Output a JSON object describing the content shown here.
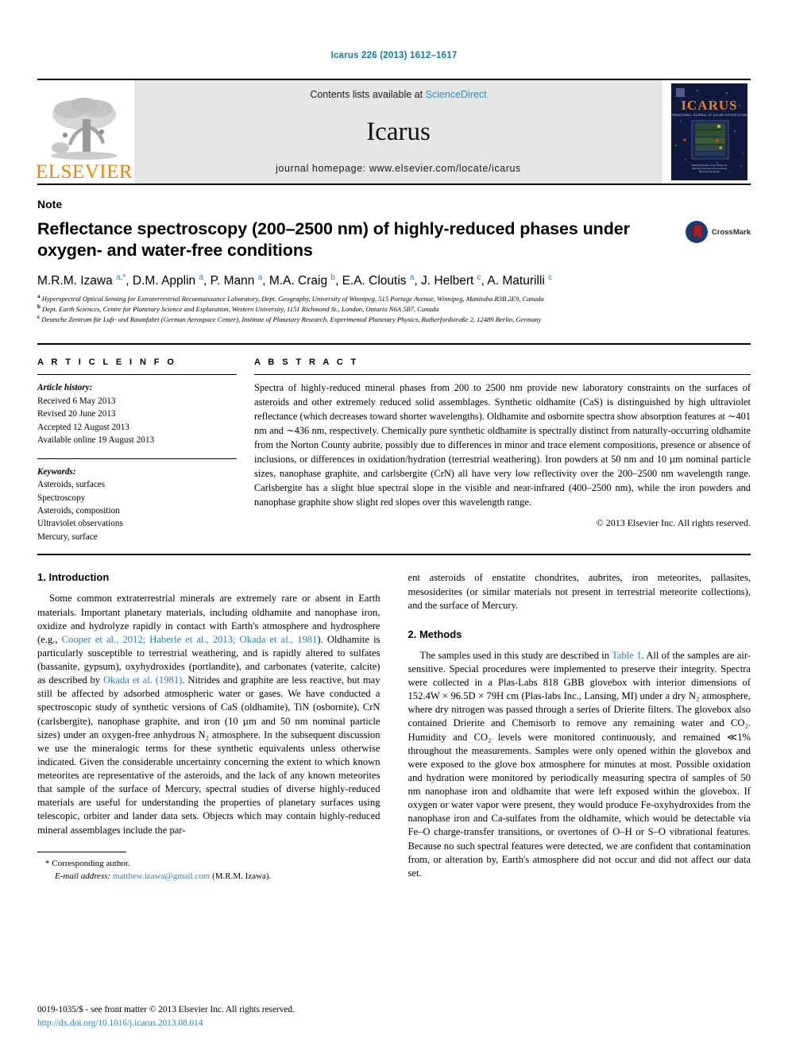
{
  "running_head": "Icarus 226 (2013) 1612–1617",
  "masthead": {
    "publisher_word": "ELSEVIER",
    "contents_prefix": "Contents lists available at ",
    "contents_link": "ScienceDirect",
    "journal_name": "Icarus",
    "journal_homepage": "journal homepage: www.elsevier.com/locate/icarus",
    "cover_title": "ICARUS",
    "cover_subtitle": "INTERNATIONAL JOURNAL OF SOLAR SYSTEM STUDIES",
    "cover_footer": "Official Publication of the Division for Planetary Sciences of the American Astronomical Society"
  },
  "article": {
    "type_label": "Note",
    "title": "Reflectance spectroscopy (200–2500 nm) of highly-reduced phases under oxygen- and water-free conditions",
    "crossmark_label": "CrossMark",
    "authors_html": "M.R.M. Izawa <sup>a,*</sup>, D.M. Applin <sup>a</sup>, P. Mann <sup>a</sup>, M.A. Craig <sup>b</sup>, E.A. Cloutis <sup>a</sup>, J. Helbert <sup>c</sup>, A. Maturilli <sup>c</sup>",
    "affiliations": [
      "Hyperspectral Optical Sensing for Extraterrestrial Reconnaissance Laboratory, Dept. Geography, University of Winnipeg, 515 Portage Avenue, Winnipeg, Manitoba R3B 2E9, Canada",
      "Dept. Earth Sciences, Centre for Planetary Science and Exploration, Western University, 1151 Richmond St., London, Ontario N6A 5B7, Canada",
      "Deutsche Zentrum für Luft- und Raumfahrt (German Aerospace Center), Institute of Planetary Research, Experimental Planetary Physics, Rutherfordstraße 2, 12489 Berlin, Germany"
    ],
    "affiliation_marks": [
      "a",
      "b",
      "c"
    ]
  },
  "article_info": {
    "heading": "A R T I C L E    I N F O",
    "history_label": "Article history:",
    "history": [
      "Received 6 May 2013",
      "Revised 20 June 2013",
      "Accepted 12 August 2013",
      "Available online 19 August 2013"
    ],
    "keywords_label": "Keywords:",
    "keywords": [
      "Asteroids, surfaces",
      "Spectroscopy",
      "Asteroids, composition",
      "Ultraviolet observations",
      "Mercury, surface"
    ]
  },
  "abstract": {
    "heading": "A B S T R A C T",
    "text": "Spectra of highly-reduced mineral phases from 200 to 2500 nm provide new laboratory constraints on the surfaces of asteroids and other extremely reduced solid assemblages. Synthetic oldhamite (CaS) is distinguished by high ultraviolet reflectance (which decreases toward shorter wavelengths). Oldhamite and osbornite spectra show absorption features at ∼401 nm and ∼436 nm, respectively. Chemically pure synthetic oldhamite is spectrally distinct from naturally-occurring oldhamite from the Norton County aubrite, possibly due to differences in minor and trace element compositions, presence or absence of inclusions, or differences in oxidation/hydration (terrestrial weathering). Iron powders at 50 nm and 10 µm nominal particle sizes, nanophase graphite, and carlsbergite (CrN) all have very low reflectivity over the 200–2500 nm wavelength range. Carlsbergite has a slight blue spectral slope in the visible and near-infrared (400–2500 nm), while the iron powders and nanophase graphite show slight red slopes over this wavelength range.",
    "copyright": "© 2013 Elsevier Inc. All rights reserved."
  },
  "body": {
    "intro_heading": "1. Introduction",
    "methods_heading": "2. Methods",
    "intro_p1_a": "Some common extraterrestrial minerals are extremely rare or absent in Earth materials. Important planetary materials, including oldhamite and nanophase iron, oxidize and hydrolyze rapidly in contact with Earth's atmosphere and hydrosphere (e.g., ",
    "intro_ref1": "Cooper et al., 2012; Haberle et al., 2013; Okada et al., 1981",
    "intro_p1_b": "). Oldhamite is particularly susceptible to terrestrial weathering, and is rapidly altered to sulfates (bassanite, gypsum), oxyhydroxides (portlandite), and carbonates (vaterite, calcite) as described by ",
    "intro_ref2": "Okada et al. (1981)",
    "intro_p1_c": ". Nitrides and graphite are less reactive, but may still be affected by adsorbed atmospheric water or gases. We have conducted a spectroscopic study of synthetic versions of CaS (oldhamite), TiN (osbornite), CrN (carlsbergite), nanophase graphite, and iron (10 µm and 50 nm nominal particle sizes) under an oxygen-free anhydrous N₂ atmosphere. In the subsequent discussion we use the mineralogic terms for these synthetic equivalents unless otherwise indicated. Given the considerable uncertainty concerning the extent to which known meteorites are representative of the asteroids, and the lack of any known meteorites that sample of the surface of Mercury, spectral studies of diverse highly-reduced materials are useful for understanding the properties of planetary surfaces using telescopic, orbiter and lander data sets. Objects which may contain highly-reduced mineral assemblages include the par-",
    "intro_p1_cont": "ent asteroids of enstatite chondrites, aubrites, iron meteorites, pallasites, mesosiderites (or similar materials not present in terrestrial meteorite collections), and the surface of Mercury.",
    "methods_p1_a": "The samples used in this study are described in ",
    "methods_ref_table": "Table 1",
    "methods_p1_b": ". All of the samples are air-sensitive. Special procedures were implemented to preserve their integrity. Spectra were collected in a Plas-Labs 818 GBB glovebox with interior dimensions of 152.4W × 96.5D × 79H cm (Plas-labs Inc., Lansing, MI) under a dry N₂ atmosphere, where dry nitrogen was passed through a series of Drierite filters. The glovebox also contained Drierite and Chemisorb to remove any remaining water and CO₂. Humidity and CO₂ levels were monitored continuously, and remained ≪1% throughout the measurements. Samples were only opened within the glovebox and were exposed to the glove box atmosphere for minutes at most. Possible oxidation and hydration were monitored by periodically measuring spectra of samples of 50 nm nanophase iron and oldhamite that were left exposed within the glovebox. If oxygen or water vapor were present, they would produce Fe-oxyhydroxides from the nanophase iron and Ca-sulfates from the oldhamite, which would be detectable via Fe–O charge-transfer transitions, or overtones of O–H or S–O vibrational features. Because no such spectral features were detected, we are confident that contamination from, or alteration by, Earth's atmosphere did not occur and did not affect our data set."
  },
  "footnotes": {
    "corresponding_marker": "*",
    "corresponding_text": "Corresponding author.",
    "email_label": "E-mail address:",
    "email": "matthew.izawa@gmail.com",
    "email_suffix": "(M.R.M. Izawa)."
  },
  "imprint": {
    "line1": "0019-1035/$ - see front matter © 2013 Elsevier Inc. All rights reserved.",
    "doi": "http://dx.doi.org/10.1016/j.icarus.2013.08.014"
  },
  "colors": {
    "link": "#1f83b8",
    "running_head": "#0b7ba8",
    "elsevier_orange": "#ef8200",
    "band_gray": "#e6e6e6",
    "crossmark_blue": "#1a3b73",
    "crossmark_red": "#a82020",
    "cover_navy": "#101a3e"
  }
}
